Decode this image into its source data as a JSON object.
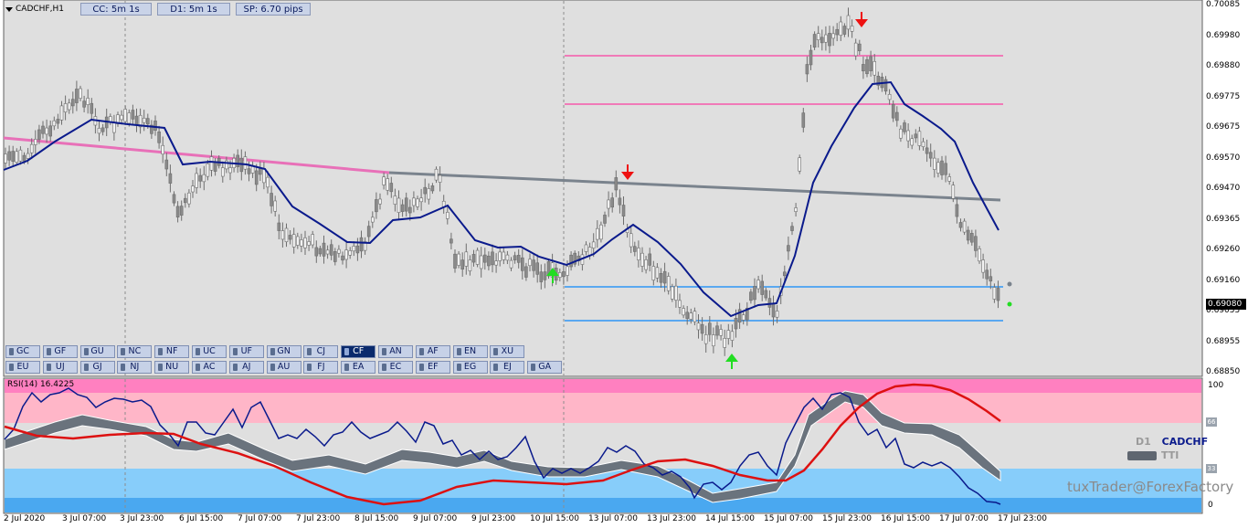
{
  "window": {
    "symbol_title": "CADCHF,H1"
  },
  "info_boxes": [
    {
      "id": "cc",
      "label": "CC:  5m 1s"
    },
    {
      "id": "d1",
      "label": "D1:  5m 1s"
    },
    {
      "id": "sp",
      "label": "SP: 6.70 pips"
    }
  ],
  "pairs_row1": [
    "GC",
    "GF",
    "GU",
    "NC",
    "NF",
    "UC",
    "UF",
    "GN",
    "CJ",
    "CF",
    "AN",
    "AF",
    "EN",
    "XU"
  ],
  "pairs_row2": [
    "EU",
    "UJ",
    "GJ",
    "NJ",
    "NU",
    "AC",
    "AJ",
    "AU",
    "FJ",
    "EA",
    "EC",
    "EF",
    "EG",
    "EJ",
    "GA"
  ],
  "active_pair": "CF",
  "price_axis": [
    "0.70085",
    "0.69980",
    "0.69880",
    "0.69775",
    "0.69675",
    "0.69570",
    "0.69470",
    "0.69365",
    "0.69260",
    "0.69160",
    "0.69055",
    "0.68955",
    "0.68850"
  ],
  "current_price": "0.69080",
  "time_axis": [
    "2 Jul 2020",
    "3 Jul 07:00",
    "3 Jul 23:00",
    "6 Jul 15:00",
    "7 Jul 07:00",
    "7 Jul 23:00",
    "8 Jul 15:00",
    "9 Jul 07:00",
    "9 Jul 23:00",
    "10 Jul 15:00",
    "13 Jul 07:00",
    "13 Jul 23:00",
    "14 Jul 15:00",
    "15 Jul 07:00",
    "15 Jul 23:00",
    "16 Jul 15:00",
    "17 Jul 07:00",
    "17 Jul 23:00"
  ],
  "rsi_panel": {
    "label": "RSI(14) 16.4225",
    "scale": [
      "100",
      "0"
    ],
    "level_tags": [
      "66",
      "33"
    ]
  },
  "tti_legend": {
    "timeframe": "D1",
    "pair": "CADCHF",
    "name": "TTI"
  },
  "watermark": "tuxTrader@ForexFactory",
  "colors": {
    "bull_arrow": "#22dd22",
    "bear_arrow": "#ee1111",
    "ma_line": "#0a1a8c",
    "trend_pink": "#e870b8",
    "trend_gray": "#7a838d",
    "level_pink": "#f07ab8",
    "level_blue": "#5aa8f0",
    "rsi_line": "#0a1a8c",
    "signal_line": "#dd1111"
  }
}
